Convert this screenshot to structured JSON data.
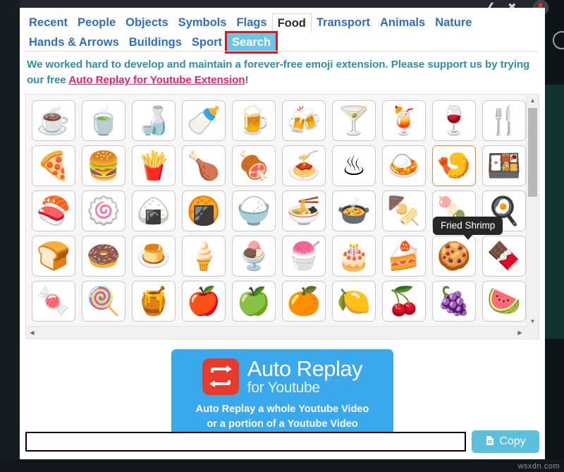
{
  "browser": {
    "back_icon": "back-arrow-icon",
    "star_icon": "star-icon",
    "avatar_icon": "profile-avatar-icon",
    "magnifier_icon": "search-magnifier-icon"
  },
  "tabs": {
    "row1": [
      {
        "label": "Recent",
        "state": "link"
      },
      {
        "label": "People",
        "state": "link"
      },
      {
        "label": "Objects",
        "state": "link"
      },
      {
        "label": "Symbols",
        "state": "link"
      },
      {
        "label": "Flags",
        "state": "link"
      },
      {
        "label": "Food",
        "state": "active"
      },
      {
        "label": "Transport",
        "state": "link"
      },
      {
        "label": "Animals",
        "state": "link"
      },
      {
        "label": "Nature",
        "state": "link"
      }
    ],
    "row2": [
      {
        "label": "Hands & Arrows",
        "state": "link"
      },
      {
        "label": "Buildings",
        "state": "link"
      },
      {
        "label": "Sport",
        "state": "link"
      },
      {
        "label": "Search",
        "state": "selected"
      }
    ],
    "highlight_color": "#e8160c",
    "selected_bg": "#6cc4e8"
  },
  "promo": {
    "text_before": "We worked hard to develop and maintain a forever-free emoji extension. Please support us by trying our free ",
    "link": "Auto Replay for Youtube Extension",
    "text_after": "!",
    "text_color": "#2f8fa8",
    "link_color": "#e5226b"
  },
  "grid": {
    "rows": [
      [
        {
          "name": "hot-beverage",
          "glyph": "☕"
        },
        {
          "name": "teacup-without-handle",
          "glyph": "🍵"
        },
        {
          "name": "sake",
          "glyph": "🍶"
        },
        {
          "name": "baby-bottle",
          "glyph": "🍼"
        },
        {
          "name": "beer-mug",
          "glyph": "🍺"
        },
        {
          "name": "clinking-beer-mugs",
          "glyph": "🍻"
        },
        {
          "name": "cocktail-glass",
          "glyph": "🍸"
        },
        {
          "name": "tropical-drink",
          "glyph": "🍹"
        },
        {
          "name": "wine-glass",
          "glyph": "🍷"
        },
        {
          "name": "fork-and-knife",
          "glyph": "🍴"
        }
      ],
      [
        {
          "name": "pizza",
          "glyph": "🍕"
        },
        {
          "name": "hamburger",
          "glyph": "🍔"
        },
        {
          "name": "french-fries",
          "glyph": "🍟"
        },
        {
          "name": "poultry-leg",
          "glyph": "🍗"
        },
        {
          "name": "meat-on-bone",
          "glyph": "🍖"
        },
        {
          "name": "spaghetti",
          "glyph": "🍝"
        },
        {
          "name": "hot-springs",
          "glyph": "♨"
        },
        {
          "name": "curry-rice",
          "glyph": "🍛"
        },
        {
          "name": "fried-shrimp",
          "glyph": "🍤",
          "hovered": true
        },
        {
          "name": "bento-box",
          "glyph": "🍱"
        }
      ],
      [
        {
          "name": "sushi",
          "glyph": "🍣"
        },
        {
          "name": "fish-cake-with-swirl",
          "glyph": "🍥"
        },
        {
          "name": "rice-ball",
          "glyph": "🍙"
        },
        {
          "name": "rice-cracker",
          "glyph": "🍘"
        },
        {
          "name": "cooked-rice",
          "glyph": "🍚"
        },
        {
          "name": "steaming-bowl",
          "glyph": "🍜"
        },
        {
          "name": "pot-of-food",
          "glyph": "🍲"
        },
        {
          "name": "oden",
          "glyph": "🍢"
        },
        {
          "name": "dango",
          "glyph": "🍡"
        },
        {
          "name": "cooking",
          "glyph": "🍳"
        }
      ],
      [
        {
          "name": "bread",
          "glyph": "🍞"
        },
        {
          "name": "doughnut",
          "glyph": "🍩"
        },
        {
          "name": "custard",
          "glyph": "🍮"
        },
        {
          "name": "soft-ice-cream",
          "glyph": "🍦"
        },
        {
          "name": "ice-cream",
          "glyph": "🍨"
        },
        {
          "name": "shaved-ice",
          "glyph": "🍧"
        },
        {
          "name": "birthday-cake",
          "glyph": "🎂"
        },
        {
          "name": "shortcake",
          "glyph": "🍰"
        },
        {
          "name": "cookie",
          "glyph": "🍪"
        },
        {
          "name": "chocolate-bar",
          "glyph": "🍫"
        }
      ],
      [
        {
          "name": "candy",
          "glyph": "🍬"
        },
        {
          "name": "lollipop",
          "glyph": "🍭"
        },
        {
          "name": "honey-pot",
          "glyph": "🍯"
        },
        {
          "name": "red-apple",
          "glyph": "🍎"
        },
        {
          "name": "green-apple",
          "glyph": "🍏"
        },
        {
          "name": "tangerine",
          "glyph": "🍊"
        },
        {
          "name": "lemon",
          "glyph": "🍋"
        },
        {
          "name": "cherries",
          "glyph": "🍒"
        },
        {
          "name": "grapes",
          "glyph": "🍇"
        },
        {
          "name": "watermelon",
          "glyph": "🍉"
        }
      ]
    ]
  },
  "tooltip": {
    "label": "Fried Shrimp"
  },
  "scrollbar": {
    "up_arrow": "▲",
    "down_arrow": "▼",
    "left_arrow": "◀",
    "right_arrow": "▶"
  },
  "banner": {
    "title": "Auto Replay",
    "subtitle": "for Youtube",
    "desc_line1": "Auto Replay a whole Youtube Video",
    "desc_line2": "or a portion of a Youtube Video",
    "bg_color": "#3aa9ec",
    "logo_color": "#e8392b",
    "logo_icon": "repeat-loop-icon"
  },
  "bottom": {
    "input_value": "",
    "input_placeholder": "",
    "copy_label": "Copy",
    "copy_icon": "clipboard-copy-icon",
    "copy_color": "#5bc0de"
  },
  "watermark": {
    "text": "wsxdn.com"
  }
}
